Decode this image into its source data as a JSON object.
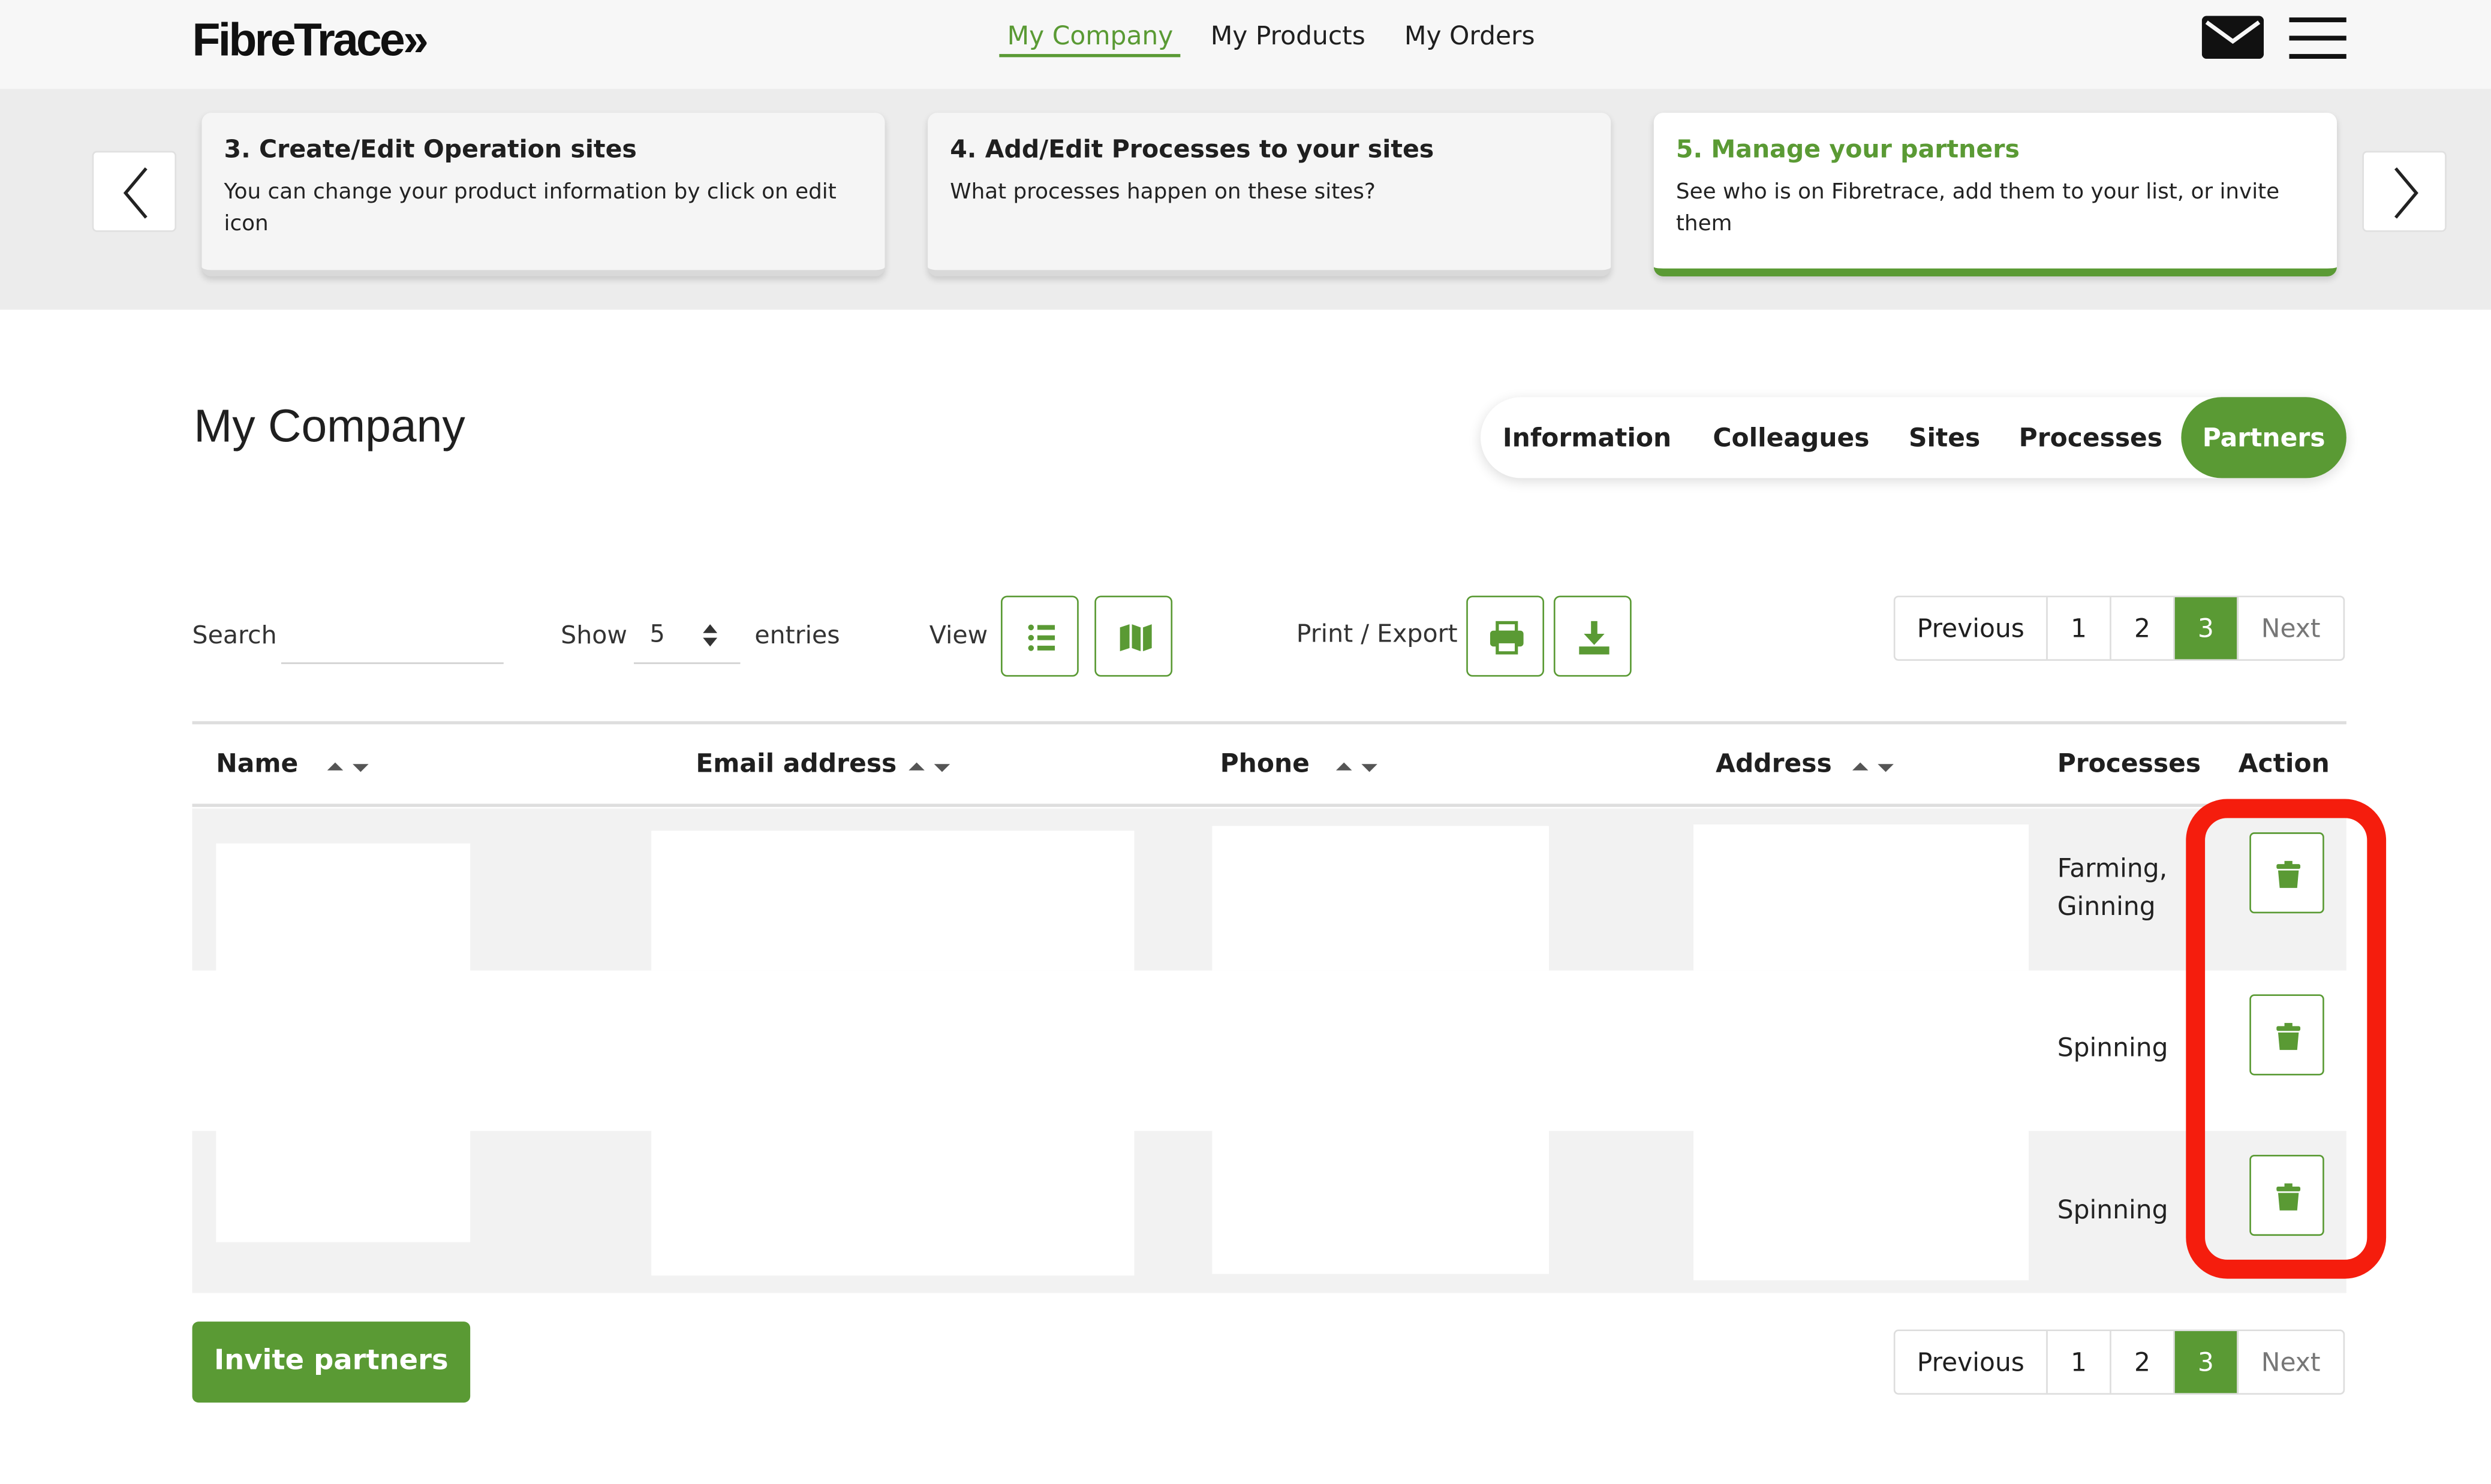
{
  "nav": {
    "logo": "FibreTrace»",
    "links": [
      "My Company",
      "My Products",
      "My Orders"
    ]
  },
  "onboarding": {
    "cards": [
      {
        "title": "3. Create/Edit Operation sites",
        "text": "You can change your product information by click on edit icon"
      },
      {
        "title": "4. Add/Edit Processes to your sites",
        "text": "What processes happen on these sites?"
      },
      {
        "title": "5. Manage your partners",
        "text": "See who is on Fibretrace, add them to your list, or invite them"
      }
    ]
  },
  "page": {
    "title": "My Company"
  },
  "tabs": [
    "Information",
    "Colleagues",
    "Sites",
    "Processes",
    "Partners"
  ],
  "toolbar": {
    "search_label": "Search",
    "show_label": "Show",
    "show_value": "5",
    "entries_label": "entries",
    "view_label": "View",
    "print_export_label": "Print / Export"
  },
  "pagination": {
    "previous": "Previous",
    "pages": [
      "1",
      "2",
      "3"
    ],
    "next": "Next",
    "current_page": 3
  },
  "table": {
    "headers": [
      "Name",
      "Email address",
      "Phone",
      "Address",
      "Processes",
      "Action"
    ],
    "rows": [
      {
        "processes": "Farming, Ginning"
      },
      {
        "processes": "Spinning"
      },
      {
        "processes": "Spinning"
      }
    ]
  },
  "invite_button": "Invite partners",
  "colors": {
    "accent": "#5a9a34",
    "highlight": "#f51d0d",
    "band": "#ececec"
  }
}
